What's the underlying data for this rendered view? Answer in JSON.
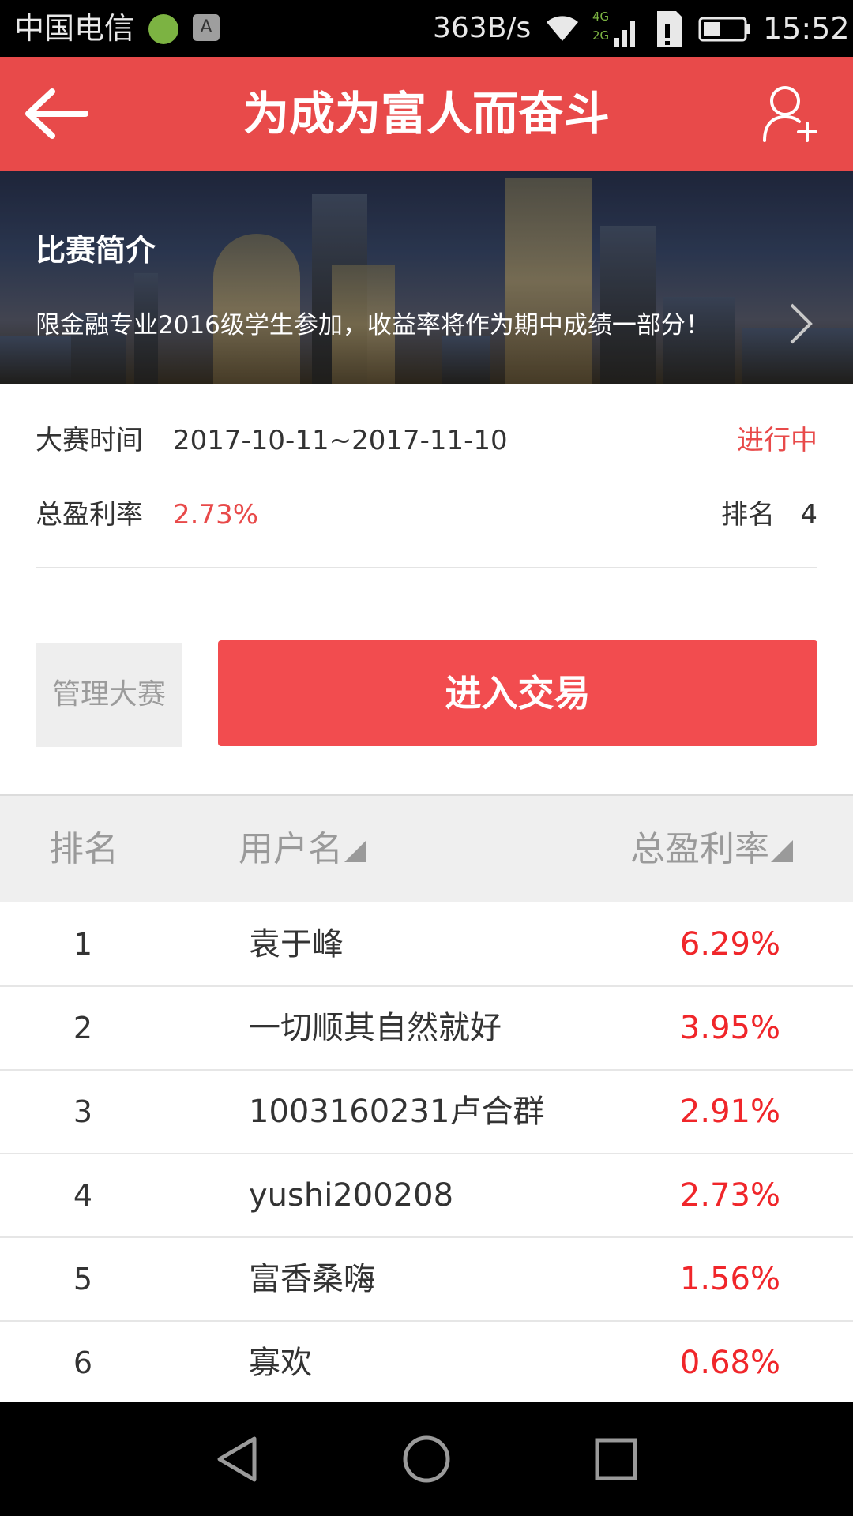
{
  "status_bar": {
    "carrier": "中国电信",
    "net_speed": "363B/s",
    "network_types": [
      "4G",
      "2G"
    ],
    "time": "15:52",
    "app_icons": [
      "wechat-like-icon",
      "a-icon"
    ],
    "a_icon_letter": "A"
  },
  "header": {
    "title": "为成为富人而奋斗",
    "background": "#e84a4a"
  },
  "banner": {
    "title": "比赛简介",
    "description": "限金融专业2016级学生参加，收益率将作为期中成绩一部分！"
  },
  "info": {
    "time_label": "大赛时间",
    "time_value": "2017-10-11~2017-11-10",
    "status": "进行中",
    "profit_label": "总盈利率",
    "profit_value": "2.73%",
    "rank_label": "排名",
    "rank_value": "4"
  },
  "actions": {
    "manage_label": "管理大赛",
    "trade_label": "进入交易",
    "accent": "#f24c4f"
  },
  "ranking": {
    "headers": {
      "rank": "排名",
      "user": "用户名",
      "rate": "总盈利率"
    },
    "rows": [
      {
        "rank": "1",
        "user": "袁于峰",
        "rate": "6.29%"
      },
      {
        "rank": "2",
        "user": "一切顺其自然就好",
        "rate": "3.95%"
      },
      {
        "rank": "3",
        "user": "1003160231卢合群",
        "rate": "2.91%"
      },
      {
        "rank": "4",
        "user": "yushi200208",
        "rate": "2.73%"
      },
      {
        "rank": "5",
        "user": "富香桑嗨",
        "rate": "1.56%"
      },
      {
        "rank": "6",
        "user": "寡欢",
        "rate": "0.68%"
      }
    ]
  },
  "nav": {
    "icons": [
      "back-triangle-icon",
      "home-circle-icon",
      "recents-square-icon"
    ]
  }
}
